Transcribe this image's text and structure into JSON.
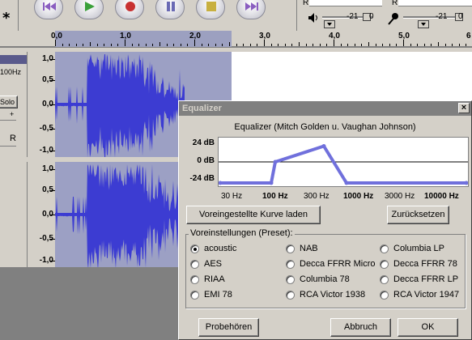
{
  "toolbar": {
    "asterisk": "*",
    "meter": {
      "left_channel_label": "R",
      "right_channel_label": "R",
      "ticks_left": [
        "-21",
        "0"
      ],
      "ticks_right": [
        "-21",
        "0"
      ]
    }
  },
  "ruler": {
    "labels": [
      "0,0",
      "1,0",
      "2,0",
      "3,0",
      "4,0",
      "5,0",
      "6"
    ]
  },
  "track": {
    "rate_label": "100Hz",
    "solo_label": "Solo",
    "pan_left_label": "+",
    "pan_right_label": "R",
    "scale_top": [
      "1,0",
      "0,5",
      "0,0",
      "-0,5",
      "-1,0"
    ],
    "scale_bottom": [
      "1,0",
      "0,5",
      "0,0",
      "-0,5",
      "-1,0"
    ]
  },
  "equalizer": {
    "title": "Equalizer",
    "close_label": "×",
    "subtitle": "Equalizer (Mitch Golden u. Vaughan Johnson)",
    "db_labels": [
      "24 dB",
      "0 dB",
      "-24 dB"
    ],
    "hz_labels": [
      "30 Hz",
      "100 Hz",
      "300 Hz",
      "1000 Hz",
      "3000 Hz",
      "10000 Hz"
    ],
    "curve_db": [
      -24,
      -24,
      0,
      18,
      -24,
      -24
    ],
    "load_curve_button": "Voreingestellte Kurve laden",
    "reset_button": "Zurücksetzen",
    "preset_legend": "Voreinstellungen (Preset):",
    "presets": [
      {
        "label": "acoustic",
        "selected": true
      },
      {
        "label": "NAB",
        "selected": false
      },
      {
        "label": "Columbia LP",
        "selected": false
      },
      {
        "label": "AES",
        "selected": false
      },
      {
        "label": "Decca FFRR Micro",
        "selected": false
      },
      {
        "label": "Decca FFRR 78",
        "selected": false
      },
      {
        "label": "RIAA",
        "selected": false
      },
      {
        "label": "Columbia 78",
        "selected": false
      },
      {
        "label": "Decca FFRR LP",
        "selected": false
      },
      {
        "label": "EMI 78",
        "selected": false
      },
      {
        "label": "RCA Victor 1938",
        "selected": false
      },
      {
        "label": "RCA Victor 1947",
        "selected": false
      }
    ],
    "preview_button": "Probehören",
    "cancel_button": "Abbruch",
    "ok_button": "OK"
  },
  "colors": {
    "waveform": "#3c3cd2",
    "selection": "#9ca0c4",
    "eq_curve": "#7070dc"
  }
}
